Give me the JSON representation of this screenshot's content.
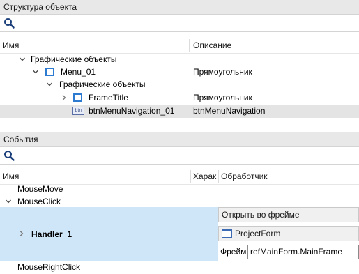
{
  "structure_panel": {
    "title": "Структура объекта",
    "search_value": "",
    "columns": {
      "name": "Имя",
      "description": "Описание"
    },
    "rows": [
      {
        "label": "Графические объекты",
        "description": ""
      },
      {
        "label": "Menu_01",
        "description": "Прямоугольник"
      },
      {
        "label": "Графические объекты",
        "description": ""
      },
      {
        "label": "FrameTitle",
        "description": "Прямоугольник"
      },
      {
        "label": "btnMenuNavigation_01",
        "description": "btnMenuNavigation",
        "icon_text": "btn"
      }
    ]
  },
  "events_panel": {
    "title": "События",
    "search_value": "",
    "columns": {
      "name": "Имя",
      "char": "Харак",
      "handler": "Обработчик"
    },
    "rows": [
      {
        "label": "MouseMove"
      },
      {
        "label": "MouseClick"
      },
      {
        "label": "Handler_1"
      },
      {
        "label": "MouseRightClick"
      }
    ],
    "handler_editor": {
      "open_in_frame_label": "Открыть во фрейме",
      "form_button_label": "ProjectForm",
      "frame_label": "Фрейм",
      "frame_value": "refMainForm.MainFrame"
    }
  },
  "colors": {
    "header_bg": "#e8e8e8",
    "selected_row": "#e4e4e4",
    "handler_highlight": "#cfe5f8",
    "object_icon": "#2c7bd1"
  }
}
